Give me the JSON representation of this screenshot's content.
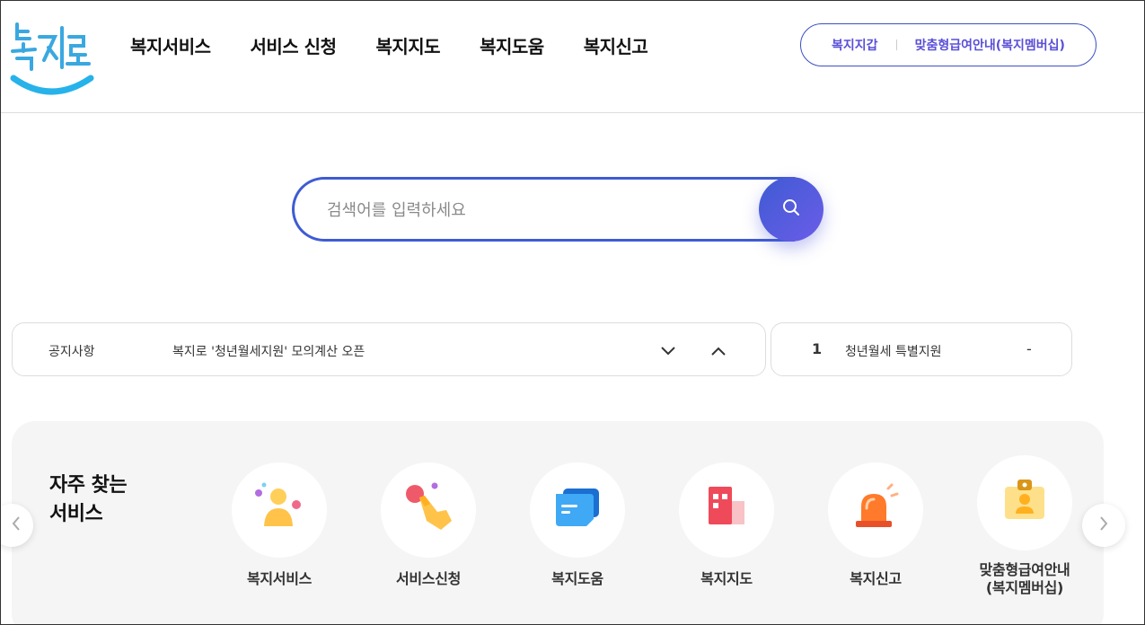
{
  "header": {
    "logo_text": "복지로",
    "nav": [
      {
        "label": "복지서비스"
      },
      {
        "label": "서비스 신청"
      },
      {
        "label": "복지지도"
      },
      {
        "label": "복지도움"
      },
      {
        "label": "복지신고"
      }
    ],
    "util": {
      "wallet_label": "복지지갑",
      "membership_label": "맞춤형급여안내(복지멤버십)"
    }
  },
  "search": {
    "placeholder": "검색어를 입력하세요",
    "value": ""
  },
  "notice": {
    "label": "공지사항",
    "text": "복지로 '청년월세지원' 모의계산 오픈"
  },
  "ranking": {
    "number": "1",
    "text": "청년월세 특별지원",
    "change": "-"
  },
  "favorites": {
    "title_line1": "자주 찾는",
    "title_line2": "서비스",
    "items": [
      {
        "label": "복지서비스",
        "icon": "person-icon"
      },
      {
        "label": "서비스신청",
        "icon": "pointing-hand-icon"
      },
      {
        "label": "복지도움",
        "icon": "chat-icon"
      },
      {
        "label": "복지지도",
        "icon": "map-building-icon"
      },
      {
        "label": "복지신고",
        "icon": "siren-icon"
      },
      {
        "label": "맞춤형급여안내\n(복지멤버십)",
        "label_line1": "맞춤형급여안내",
        "label_line2": "(복지멤버십)",
        "icon": "id-card-icon"
      }
    ]
  },
  "colors": {
    "accent": "#3f5bd3",
    "util_text": "#5a4fd8",
    "panel_bg": "#f5f5f6"
  }
}
